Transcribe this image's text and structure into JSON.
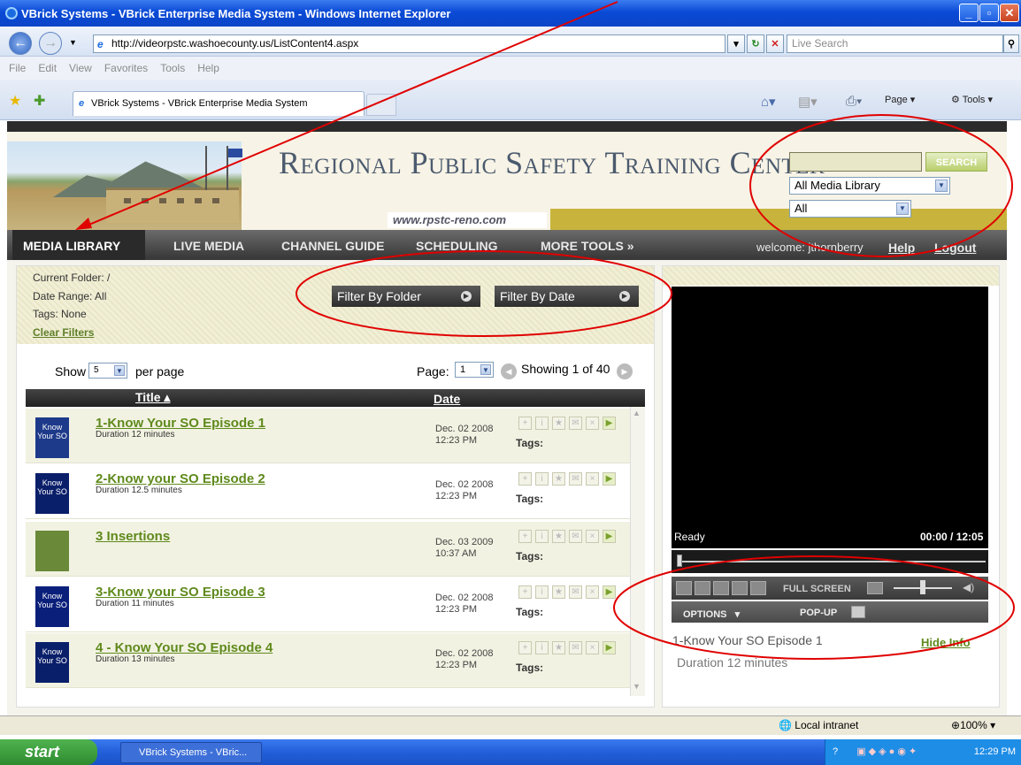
{
  "window": {
    "title": "VBrick Systems - VBrick Enterprise Media System - Windows Internet Explorer",
    "address": "http://videorpstc.washoecounty.us/ListContent4.aspx",
    "live_search_placeholder": "Live Search",
    "menu": [
      "File",
      "Edit",
      "View",
      "Favorites",
      "Tools",
      "Help"
    ],
    "tab_label": "VBrick Systems - VBrick Enterprise Media System",
    "toolbar": {
      "page": "Page",
      "tools": "Tools"
    }
  },
  "site": {
    "title": "Regional Public Safety Training Center",
    "url": "www.rpstc-reno.com",
    "search_button": "SEARCH",
    "library_select": "All Media Library",
    "type_select": "All"
  },
  "nav": {
    "items": [
      "MEDIA LIBRARY",
      "LIVE MEDIA",
      "CHANNEL GUIDE",
      "SCHEDULING",
      "MORE TOOLS »"
    ],
    "welcome": "welcome: jthornberry",
    "help": "Help",
    "logout": "Logout"
  },
  "filters": {
    "current_folder": "Current Folder: /",
    "date_range": "Date Range: All",
    "tags": "Tags: None",
    "clear": "Clear Filters",
    "by_folder": "Filter By Folder",
    "by_date": "Filter By Date"
  },
  "paging": {
    "show": "Show",
    "per_page_value": "5",
    "per_page": "per page",
    "page_label": "Page:",
    "page_value": "1",
    "showing": "Showing 1 of 40"
  },
  "table": {
    "col_title": "Title",
    "col_date": "Date",
    "tags_label": "Tags:",
    "rows": [
      {
        "title": "1-Know Your SO Episode 1",
        "duration": "Duration 12 minutes",
        "date": "Dec. 02 2008",
        "time": "12:23 PM",
        "thumb": "Know Your SO"
      },
      {
        "title": "2-Know your SO Episode 2",
        "duration": "Duration 12.5 minutes",
        "date": "Dec. 02 2008",
        "time": "12:23 PM",
        "thumb": "Know Your SO"
      },
      {
        "title": "3 Insertions",
        "duration": "",
        "date": "Dec. 03 2009",
        "time": "10:37 AM",
        "thumb": ""
      },
      {
        "title": "3-Know your SO Episode 3",
        "duration": "Duration 11 minutes",
        "date": "Dec. 02 2008",
        "time": "12:23 PM",
        "thumb": "Know Your SO"
      },
      {
        "title": "4 - Know Your SO Episode 4",
        "duration": "Duration 13 minutes",
        "date": "Dec. 02 2008",
        "time": "12:23 PM",
        "thumb": "Know Your SO"
      }
    ]
  },
  "player": {
    "status": "Ready",
    "time": "00:00 / 12:05",
    "full_screen": "FULL SCREEN",
    "options": "OPTIONS",
    "popup": "POP-UP",
    "info_title": "1-Know Your SO Episode 1",
    "hide_info": "Hide Info",
    "info_duration": "Duration 12 minutes"
  },
  "status": {
    "zone": "Local intranet",
    "zoom": "100%"
  },
  "taskbar": {
    "start": "start",
    "item": "VBrick Systems - VBric...",
    "clock": "12:29 PM"
  },
  "colors": {
    "accent_green": "#5f8a1c",
    "nav_dark": "#3a3a3a",
    "annotation_red": "#e00000"
  }
}
